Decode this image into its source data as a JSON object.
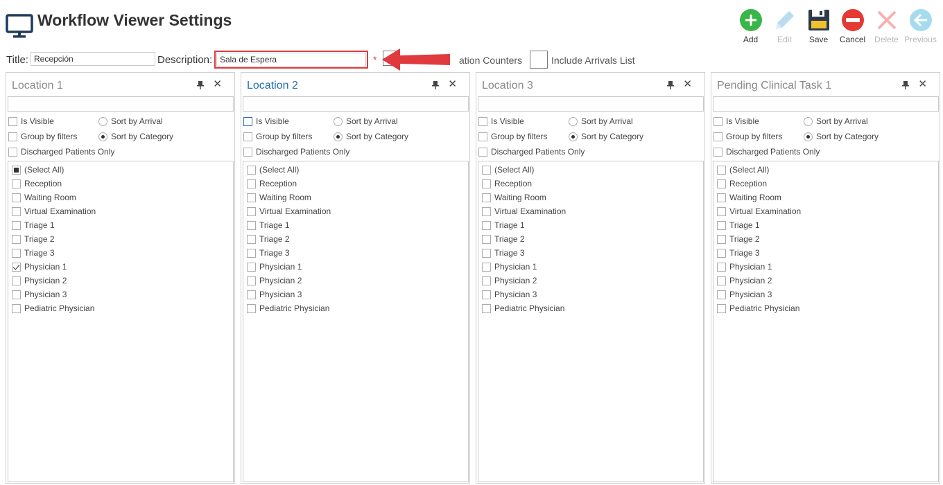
{
  "header": {
    "title": "Workflow Viewer Settings",
    "app_icon": "monitor-icon"
  },
  "toolbar": [
    {
      "name": "add-button",
      "label": "Add",
      "icon": "add-icon",
      "color": "#3ab54a",
      "enabled": true
    },
    {
      "name": "edit-button",
      "label": "Edit",
      "icon": "pencil-icon",
      "color": "#b9dcf2",
      "enabled": false
    },
    {
      "name": "save-button",
      "label": "Save",
      "icon": "floppy-icon",
      "color": "#2d3a4a",
      "enabled": true
    },
    {
      "name": "cancel-button",
      "label": "Cancel",
      "icon": "no-entry-icon",
      "color": "#e53935",
      "enabled": true
    },
    {
      "name": "delete-button",
      "label": "Delete",
      "icon": "x-icon",
      "color": "#f7b2b2",
      "enabled": false
    },
    {
      "name": "previous-button",
      "label": "Previous",
      "icon": "arrow-left-icon",
      "color": "#a6dbef",
      "enabled": false
    }
  ],
  "form": {
    "title_label": "Title:",
    "title_value": "Recepción",
    "description_label": "Description:",
    "description_value": "Sala de Espera",
    "required_mark": "*",
    "option1_label": "ation Counters",
    "option2_label": "Include Arrivals List"
  },
  "colors": {
    "accent": "#1f6fb5",
    "highlight": "#e0393e"
  },
  "panels": [
    {
      "title": "Location 1",
      "active": false,
      "is_visible": "Is Visible",
      "group_by": "Group by filters",
      "discharged": "Discharged Patients Only",
      "sort_arrival": "Sort by Arrival",
      "sort_category": "Sort by Category",
      "sort_selected": "category",
      "items": [
        {
          "label": "(Select All)",
          "state": "partial"
        },
        {
          "label": "Reception",
          "state": "unchecked"
        },
        {
          "label": "Waiting Room",
          "state": "unchecked"
        },
        {
          "label": "Virtual Examination",
          "state": "unchecked"
        },
        {
          "label": "Triage 1",
          "state": "unchecked"
        },
        {
          "label": "Triage 2",
          "state": "unchecked"
        },
        {
          "label": "Triage 3",
          "state": "unchecked"
        },
        {
          "label": "Physician 1",
          "state": "checked"
        },
        {
          "label": "Physician 2",
          "state": "unchecked"
        },
        {
          "label": "Physician 3",
          "state": "unchecked"
        },
        {
          "label": "Pediatric Physician",
          "state": "unchecked"
        }
      ]
    },
    {
      "title": "Location 2",
      "active": true,
      "is_visible": "Is Visible",
      "group_by": "Group by filters",
      "discharged": "Discharged Patients Only",
      "sort_arrival": "Sort by Arrival",
      "sort_category": "Sort by Category",
      "sort_selected": "category",
      "items": [
        {
          "label": "(Select All)",
          "state": "unchecked"
        },
        {
          "label": "Reception",
          "state": "unchecked"
        },
        {
          "label": "Waiting Room",
          "state": "unchecked"
        },
        {
          "label": "Virtual Examination",
          "state": "unchecked"
        },
        {
          "label": "Triage 1",
          "state": "unchecked"
        },
        {
          "label": "Triage 2",
          "state": "unchecked"
        },
        {
          "label": "Triage 3",
          "state": "unchecked"
        },
        {
          "label": "Physician 1",
          "state": "unchecked"
        },
        {
          "label": "Physician 2",
          "state": "unchecked"
        },
        {
          "label": "Physician 3",
          "state": "unchecked"
        },
        {
          "label": "Pediatric Physician",
          "state": "unchecked"
        }
      ]
    },
    {
      "title": "Location 3",
      "active": false,
      "is_visible": "Is Visible",
      "group_by": "Group by filters",
      "discharged": "Discharged Patients Only",
      "sort_arrival": "Sort by Arrival",
      "sort_category": "Sort by Category",
      "sort_selected": "category",
      "items": [
        {
          "label": "(Select All)",
          "state": "unchecked"
        },
        {
          "label": "Reception",
          "state": "unchecked"
        },
        {
          "label": "Waiting Room",
          "state": "unchecked"
        },
        {
          "label": "Virtual Examination",
          "state": "unchecked"
        },
        {
          "label": "Triage 1",
          "state": "unchecked"
        },
        {
          "label": "Triage 2",
          "state": "unchecked"
        },
        {
          "label": "Triage 3",
          "state": "unchecked"
        },
        {
          "label": "Physician 1",
          "state": "unchecked"
        },
        {
          "label": "Physician 2",
          "state": "unchecked"
        },
        {
          "label": "Physician 3",
          "state": "unchecked"
        },
        {
          "label": "Pediatric Physician",
          "state": "unchecked"
        }
      ]
    },
    {
      "title": "Pending Clinical Task 1",
      "active": false,
      "is_visible": "Is Visible",
      "group_by": "Group by filters",
      "discharged": "Discharged Patients Only",
      "sort_arrival": "Sort by Arrival",
      "sort_category": "Sort by Category",
      "sort_selected": "category",
      "items": [
        {
          "label": "(Select All)",
          "state": "unchecked"
        },
        {
          "label": "Reception",
          "state": "unchecked"
        },
        {
          "label": "Waiting Room",
          "state": "unchecked"
        },
        {
          "label": "Virtual Examination",
          "state": "unchecked"
        },
        {
          "label": "Triage 1",
          "state": "unchecked"
        },
        {
          "label": "Triage 2",
          "state": "unchecked"
        },
        {
          "label": "Triage 3",
          "state": "unchecked"
        },
        {
          "label": "Physician 1",
          "state": "unchecked"
        },
        {
          "label": "Physician 2",
          "state": "unchecked"
        },
        {
          "label": "Physician 3",
          "state": "unchecked"
        },
        {
          "label": "Pediatric Physician",
          "state": "unchecked"
        }
      ]
    }
  ]
}
